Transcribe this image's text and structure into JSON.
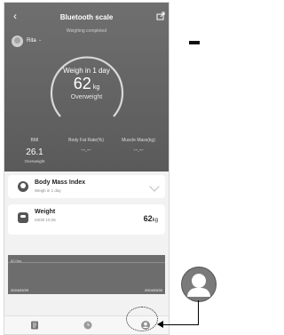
{
  "header": {
    "title": "Bluetooth scale",
    "subtitle": "Weighing completed"
  },
  "user": {
    "name": "Rita"
  },
  "gauge": {
    "label": "Weigh in 1 day",
    "value": "62",
    "unit": "kg",
    "status": "Overweight"
  },
  "metrics": [
    {
      "label": "BMI",
      "value": "26.1",
      "status": "Overweight"
    },
    {
      "label": "Body Fat Rate(%)",
      "value": "--.--"
    },
    {
      "label": "Muscle Mass(kg)",
      "value": "--.--"
    }
  ],
  "cards": {
    "bmi": {
      "title": "Body Mass Index",
      "subtitle": "Weigh in 1 day"
    },
    "weight": {
      "title": "Weight",
      "subtitle": "03/30 10:25",
      "value": "62",
      "unit": "kg"
    }
  },
  "chart": {
    "y_label": "62.0kg",
    "start_date": "2024/03/29",
    "end_date": "2024/03/30"
  },
  "tabbar": {
    "tabs": [
      "document-icon",
      "history-icon",
      "profile-icon"
    ]
  },
  "colors": {
    "hero_bg": "#666666",
    "accent": "#222222",
    "page_bg": "#f2f2f2"
  }
}
